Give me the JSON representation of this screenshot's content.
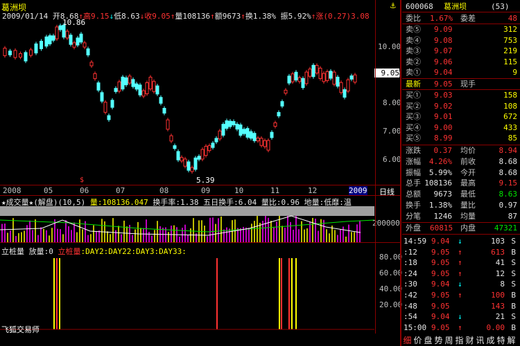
{
  "stock": {
    "name": "葛洲坝",
    "code": "600068",
    "code_name": "葛洲坝",
    "code_suffix": "(53)"
  },
  "info_bar": {
    "date": "2009/01/14",
    "open_label": "开",
    "open": "8.68",
    "high_label": "高",
    "high": "9.15",
    "low_label": "低",
    "low": "8.63",
    "close_label": "收",
    "close": "9.05",
    "vol_label": "量",
    "vol": "108136",
    "amt_label": "额",
    "amt": "9673",
    "turn_label": "换",
    "turn": "1.38%",
    "amp_label": "振",
    "amp": "5.92%",
    "chg_label": "涨",
    "chg": "(0.27)3.08"
  },
  "price_panel": {
    "y_ticks": [
      "10.00",
      "9.00",
      "8.00",
      "7.00",
      "6.00"
    ],
    "current_price": "9.05",
    "max_label": "10.86",
    "min_label": "5.39",
    "x_labels": [
      "2008",
      "05",
      "06",
      "07",
      "08",
      "09",
      "10",
      "11",
      "12",
      "2009"
    ],
    "period_label": "日线"
  },
  "volume_panel": {
    "title": "★成交量★(解盘)(10,5)",
    "vol_text": "量:108136.047",
    "turn_text": "换手率:1.38",
    "five_day_text": "五日换手:6.04",
    "ratio_text": "量比:0.96",
    "floor_text": "地量:低靡:温",
    "y_tick": "200000"
  },
  "indicator_panel": {
    "title1": "立桩量",
    "title2": "放量:0",
    "title3": "立桩量",
    "title4": ":DAY2:DAY22:DAY3:DAY33:",
    "y_ticks": [
      "80.00",
      "60.00",
      "40.00",
      "20.00"
    ],
    "footer": "飞狐交易师"
  },
  "right_panel": {
    "ratio_label": "委比",
    "ratio_value": "1.67%",
    "diff_label": "委差",
    "diff_value": "48",
    "sells": [
      {
        "label": "卖⑤",
        "price": "9.09",
        "vol": "312"
      },
      {
        "label": "卖④",
        "price": "9.08",
        "vol": "753"
      },
      {
        "label": "卖③",
        "price": "9.07",
        "vol": "219"
      },
      {
        "label": "卖②",
        "price": "9.06",
        "vol": "115"
      },
      {
        "label": "卖①",
        "price": "9.04",
        "vol": "9"
      }
    ],
    "latest_label": "最新",
    "latest_value": "9.05",
    "latest_suffix": "现手",
    "buys": [
      {
        "label": "买①",
        "price": "9.03",
        "vol": "158"
      },
      {
        "label": "买②",
        "price": "9.02",
        "vol": "108"
      },
      {
        "label": "买③",
        "price": "9.01",
        "vol": "672"
      },
      {
        "label": "买④",
        "price": "9.00",
        "vol": "433"
      },
      {
        "label": "买⑤",
        "price": "8.99",
        "vol": "85"
      }
    ],
    "stats": [
      {
        "l1": "涨跌",
        "v1": "0.37",
        "c1": "red",
        "l2": "均价",
        "v2": "8.94",
        "c2": "red"
      },
      {
        "l1": "涨幅",
        "v1": "4.26%",
        "c1": "red",
        "l2": "前收",
        "v2": "8.68",
        "c2": "white"
      },
      {
        "l1": "振幅",
        "v1": "5.99%",
        "c1": "white",
        "l2": "今开",
        "v2": "8.68",
        "c2": "white"
      },
      {
        "l1": "总手",
        "v1": "108136",
        "c1": "white",
        "l2": "最高",
        "v2": "9.15",
        "c2": "red"
      },
      {
        "l1": "总额",
        "v1": "9673",
        "c1": "white",
        "l2": "最低",
        "v2": "8.63",
        "c2": "green"
      },
      {
        "l1": "换手",
        "v1": "1.38%",
        "c1": "white",
        "l2": "量比",
        "v2": "0.97",
        "c2": "white"
      },
      {
        "l1": "分笔",
        "v1": "1246",
        "c1": "white",
        "l2": "均量",
        "v2": "87",
        "c2": "white"
      }
    ],
    "outer_label": "外盘",
    "outer_value": "60815",
    "inner_label": "内盘",
    "inner_value": "47321",
    "ticks": [
      {
        "time": "14:59",
        "price": "9.04",
        "arrow": "↓",
        "vol": "103",
        "side": "S",
        "pc": "red",
        "vc": "white"
      },
      {
        "time": ":12",
        "price": "9.05",
        "arrow": "↑",
        "vol": "613",
        "side": "B",
        "pc": "red",
        "vc": "red"
      },
      {
        "time": ":18",
        "price": "9.05",
        "arrow": "↑",
        "vol": "41",
        "side": "S",
        "pc": "red",
        "vc": "white"
      },
      {
        "time": ":24",
        "price": "9.05",
        "arrow": "↑",
        "vol": "12",
        "side": "S",
        "pc": "red",
        "vc": "white"
      },
      {
        "time": ":30",
        "price": "9.04",
        "arrow": "↓",
        "vol": "8",
        "side": "S",
        "pc": "red",
        "vc": "white"
      },
      {
        "time": ":42",
        "price": "9.05",
        "arrow": "↑",
        "vol": "100",
        "side": "B",
        "pc": "red",
        "vc": "red"
      },
      {
        "time": ":48",
        "price": "9.05",
        "arrow": "",
        "vol": "143",
        "side": "B",
        "pc": "red",
        "vc": "red"
      },
      {
        "time": ":54",
        "price": "9.04",
        "arrow": "↓",
        "vol": "21",
        "side": "S",
        "pc": "red",
        "vc": "white"
      },
      {
        "time": "15:00",
        "price": "9.05",
        "arrow": "↑",
        "vol": "0.00",
        "side": "B",
        "pc": "red",
        "vc": "red"
      }
    ],
    "bottom_tabs": [
      "细",
      "价",
      "盘",
      "势",
      "周",
      "指",
      "财",
      "讯",
      "成",
      "特",
      "解"
    ]
  },
  "colors": {
    "up": "#ff3232",
    "down": "#54ffff",
    "axis": "#8b0000",
    "text": "#c0c0c0"
  }
}
